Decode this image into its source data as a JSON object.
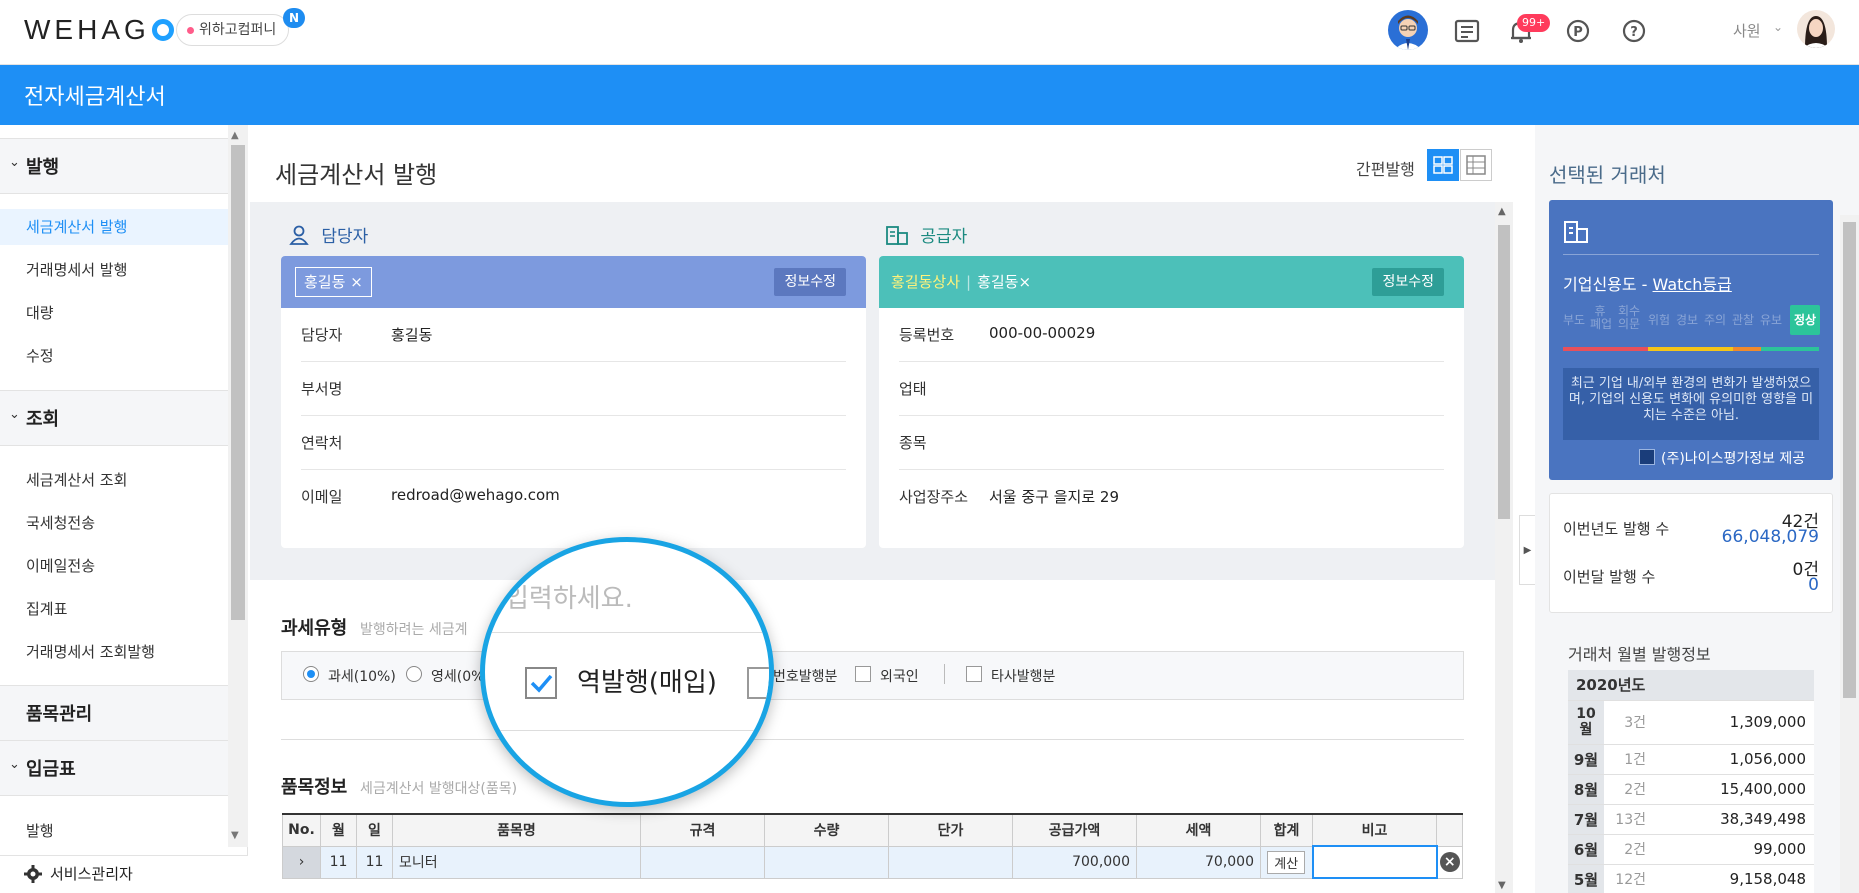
{
  "header": {
    "logo_text": "WEHAG",
    "company": "위하고컴퍼니",
    "company_badge": "N",
    "alert_count": "99+",
    "user_name": "사원"
  },
  "app": {
    "title": "전자세금계산서"
  },
  "sidebar": {
    "sections": [
      {
        "label": "발행",
        "items": [
          "세금계산서 발행",
          "거래명세서 발행",
          "대량",
          "수정"
        ]
      },
      {
        "label": "조회",
        "items": [
          "세금계산서 조회",
          "국세청전송",
          "이메일전송",
          "집계표",
          "거래명세서 조회발행"
        ]
      },
      {
        "label": "품목관리",
        "items": []
      },
      {
        "label": "입금표",
        "items": [
          "발행"
        ]
      }
    ],
    "footer": "서비스관리자"
  },
  "main": {
    "title": "세금계산서 발행",
    "quick_issue": "간편발행",
    "manager_panel": {
      "heading": "담당자",
      "chip": "홍길동",
      "edit_label": "정보수정",
      "rows": [
        {
          "key": "담당자",
          "value": "홍길동"
        },
        {
          "key": "부서명",
          "value": ""
        },
        {
          "key": "연락처",
          "value": ""
        },
        {
          "key": "이메일",
          "value": "redroad@wehago.com"
        }
      ]
    },
    "supplier_panel": {
      "heading": "공급자",
      "company": "홍길동상사",
      "person": "홍길동",
      "edit_label": "정보수정",
      "rows": [
        {
          "key": "등록번호",
          "value": "000-00-00029"
        },
        {
          "key": "업태",
          "value": ""
        },
        {
          "key": "종목",
          "value": ""
        },
        {
          "key": "사업장주소",
          "value": "서울 중구 을지로 29"
        }
      ]
    },
    "tax_type": {
      "title": "과세유형",
      "subtitle": "발행하려는 세금계",
      "options": [
        "과세(10%)",
        "영세(0%"
      ],
      "checks": [
        "번호발행분",
        "외국인",
        "타사발행분"
      ]
    },
    "items": {
      "title": "품목정보",
      "subtitle": "세금계산서 발행대상(품목)",
      "headers": [
        "No.",
        "월",
        "일",
        "품목명",
        "규격",
        "수량",
        "단가",
        "공급가액",
        "세액",
        "합계",
        "비고"
      ],
      "row": {
        "month": "11",
        "day": "11",
        "name": "모니터",
        "supply": "700,000",
        "tax": "70,000",
        "calc": "계산"
      }
    },
    "magnifier": {
      "placeholder": "입력하세요.",
      "checkbox_label": "역발행(매입)"
    }
  },
  "right": {
    "title": "선택된 거래처",
    "credit_prefix": "기업신용도 - ",
    "credit_link": "Watch등급",
    "grades": [
      "부도",
      "휴\n폐업",
      "회수\n의문",
      "위험",
      "경보",
      "주의",
      "관찰",
      "유보"
    ],
    "grade_badge": "정상",
    "credit_message": "최근 기업 내/외부 환경의 변화가 발생하였으며, 기업의 신용도 변화에 유의미한 영향을 미치는 수준은 아님.",
    "provider": "(주)나이스평가정보 제공",
    "year_label": "이번년도 발행 수",
    "year_count": "42건",
    "year_amount": "66,048,079",
    "month_label": "이번달 발행 수",
    "month_count": "0건",
    "month_amount": "0",
    "monthly_title": "거래처 월별 발행정보",
    "monthly_year": "2020년도",
    "monthly": [
      {
        "m": "10\n월",
        "c": "3건",
        "a": "1,309,000"
      },
      {
        "m": "9월",
        "c": "1건",
        "a": "1,056,000"
      },
      {
        "m": "8월",
        "c": "2건",
        "a": "15,400,000"
      },
      {
        "m": "7월",
        "c": "13건",
        "a": "38,349,498"
      },
      {
        "m": "6월",
        "c": "2건",
        "a": "99,000"
      },
      {
        "m": "5월",
        "c": "12건",
        "a": "9,158,048"
      }
    ]
  }
}
